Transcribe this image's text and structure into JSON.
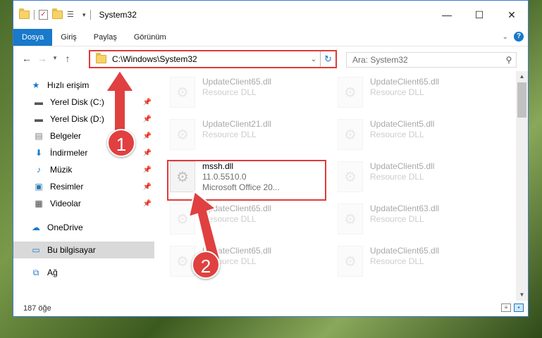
{
  "window": {
    "title": "System32",
    "controls": {
      "minimize": "—",
      "maximize": "☐",
      "close": "✕"
    }
  },
  "ribbon": {
    "tabs": [
      "Dosya",
      "Giriş",
      "Paylaş",
      "Görünüm"
    ],
    "active_tab": "Dosya"
  },
  "address": {
    "path": "C:\\Windows\\System32",
    "search_placeholder": "Ara: System32"
  },
  "nav": {
    "quick_access": "Hızlı erişim",
    "pinned": [
      {
        "label": "Yerel Disk (C:)",
        "icon": "drive-icon"
      },
      {
        "label": "Yerel Disk (D:)",
        "icon": "drive-icon"
      },
      {
        "label": "Belgeler",
        "icon": "documents-icon"
      },
      {
        "label": "İndirmeler",
        "icon": "downloads-icon"
      },
      {
        "label": "Müzik",
        "icon": "music-icon"
      },
      {
        "label": "Resimler",
        "icon": "pictures-icon"
      },
      {
        "label": "Videolar",
        "icon": "videos-icon"
      }
    ],
    "onedrive": "OneDrive",
    "this_pc": "Bu bilgisayar",
    "network": "Ağ"
  },
  "files": [
    {
      "name": "UpdateClient65.dll",
      "line2": "Resource DLL"
    },
    {
      "name": "UpdateClient65.dll",
      "line2": "Resource DLL"
    },
    {
      "name": "UpdateClient21.dll",
      "line2": "Resource DLL"
    },
    {
      "name": "UpdateClient5.dll",
      "line2": "Resource DLL"
    },
    {
      "name": "mssh.dll",
      "line2": "11.0.5510.0",
      "line3": "Microsoft Office 20..."
    },
    {
      "name": "UpdateClient5.dll",
      "line2": "Resource DLL"
    },
    {
      "name": "UpdateClient65.dll",
      "line2": "Resource DLL"
    },
    {
      "name": "UpdateClient63.dll",
      "line2": "Resource DLL"
    },
    {
      "name": "UpdateClient65.dll",
      "line2": "Resource DLL"
    },
    {
      "name": "UpdateClient65.dll",
      "line2": "Resource DLL"
    }
  ],
  "status": {
    "item_count": "187 öğe"
  },
  "annotations": {
    "step1": "1",
    "step2": "2"
  },
  "colors": {
    "accent": "#1979ca",
    "highlight": "#e03a3a",
    "badge": "#e04040"
  }
}
